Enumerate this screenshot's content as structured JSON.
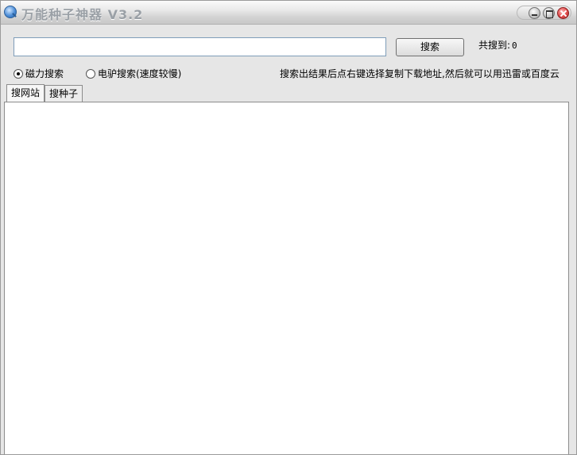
{
  "window": {
    "title": "万能种子神器 V3.2",
    "icon": "magnifier-icon"
  },
  "search": {
    "input_value": "",
    "button_label": "搜索",
    "count_label": "共搜到:",
    "count_value": "0"
  },
  "modes": [
    {
      "label": "磁力搜索",
      "checked": true
    },
    {
      "label": "电驴搜索(速度较慢)",
      "checked": false
    }
  ],
  "hint": "搜索出结果后点右键选择复制下载地址,然后就可以用迅雷或百度云",
  "tabs": [
    {
      "label": "搜网站",
      "active": true
    },
    {
      "label": "搜种子",
      "active": false
    }
  ]
}
